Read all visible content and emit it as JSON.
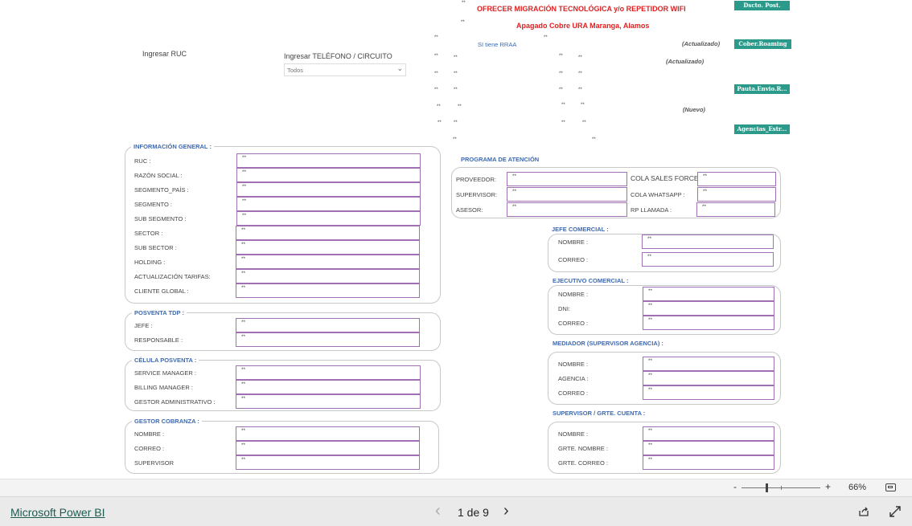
{
  "slicers": {
    "ruc": {
      "label": "Ingresar RUC"
    },
    "telefono": {
      "label": "Ingresar TELÉFONO / CIRCUITO",
      "value": "Todos"
    }
  },
  "alerts": {
    "migracion": "OFRECER MIGRACIÓN TECNOLÓGICA y/o REPETIDOR WIFI",
    "apagado": "Apagado Cobre URA Maranga, Alamos",
    "rraa": "SI tiene RRAA"
  },
  "notes": {
    "actualizado1": "(Actualizado)",
    "actualizado2": "(Actualizado)",
    "nuevo": "(Nuevo)"
  },
  "buttons": {
    "dscto": "Dscto. Post.",
    "cober": "Cober.Roaming",
    "pauta": "Pauta.Envio.R...",
    "agencias": "Agencias_Estr..."
  },
  "placeholder": "**",
  "info_general": {
    "title": "INFORMACIÓN GENERAL :",
    "rows": [
      "RUC :",
      "RAZÓN SOCIAL :",
      "SEGMENTO_PAÍS :",
      "SEGMENTO :",
      "SUB SEGMENTO :",
      "SECTOR :",
      "SUB SECTOR :",
      "HOLDING :",
      "ACTUALIZACIÓN TARIFAS:",
      "CLIENTE GLOBAL :"
    ]
  },
  "posventa": {
    "title": "POSVENTA TDP :",
    "rows": [
      "JEFE :",
      "RESPONSABLE :"
    ]
  },
  "celula": {
    "title": "CÉLULA POSVENTA :",
    "rows": [
      "SERVICE MANAGER :",
      "BILLING MANAGER :",
      "GESTOR ADMINISTRATIVO :"
    ]
  },
  "cobranza": {
    "title": "GESTOR COBRANZA :",
    "rows": [
      "NOMBRE :",
      "CORREO :",
      "SUPERVISOR"
    ]
  },
  "programa": {
    "title": "PROGRAMA DE ATENCIÓN",
    "left_rows": [
      "PROVEEDOR:",
      "SUPERVISOR:",
      "ASESOR:"
    ],
    "right_rows": [
      "COLA SALES FORCE:",
      "COLA WHATSAPP :",
      "RP LLAMADA :"
    ]
  },
  "jefe_comercial": {
    "title": "JEFE COMERCIAL :",
    "rows": [
      "NOMBRE :",
      "CORREO :"
    ]
  },
  "ejecutivo": {
    "title": "EJECUTIVO COMERCIAL :",
    "rows": [
      "NOMBRE :",
      "DNI:",
      "CORREO :"
    ]
  },
  "mediador": {
    "title": "MEDIADOR (SUPERVISOR AGENCIA) :",
    "rows": [
      "NOMBRE :",
      "AGENCIA :",
      "CORREO :"
    ]
  },
  "supervisor": {
    "title": "SUPERVISOR / GRTE. CUENTA :",
    "rows": [
      "NOMBRE :",
      "GRTE. NOMBRE :",
      "GRTE. CORREO :"
    ]
  },
  "zoom": {
    "minus": "-",
    "plus": "+",
    "level": "66%",
    "level_fraction": 0.66
  },
  "footer": {
    "brand": "Microsoft Power BI",
    "page_indicator": "1 de 9",
    "prev": "‹",
    "next": "›"
  },
  "colors": {
    "accent_blue": "#3d6ab0",
    "alert_red": "#e02020",
    "button_teal": "#2c9a8a",
    "field_border": "#a06fb4"
  }
}
